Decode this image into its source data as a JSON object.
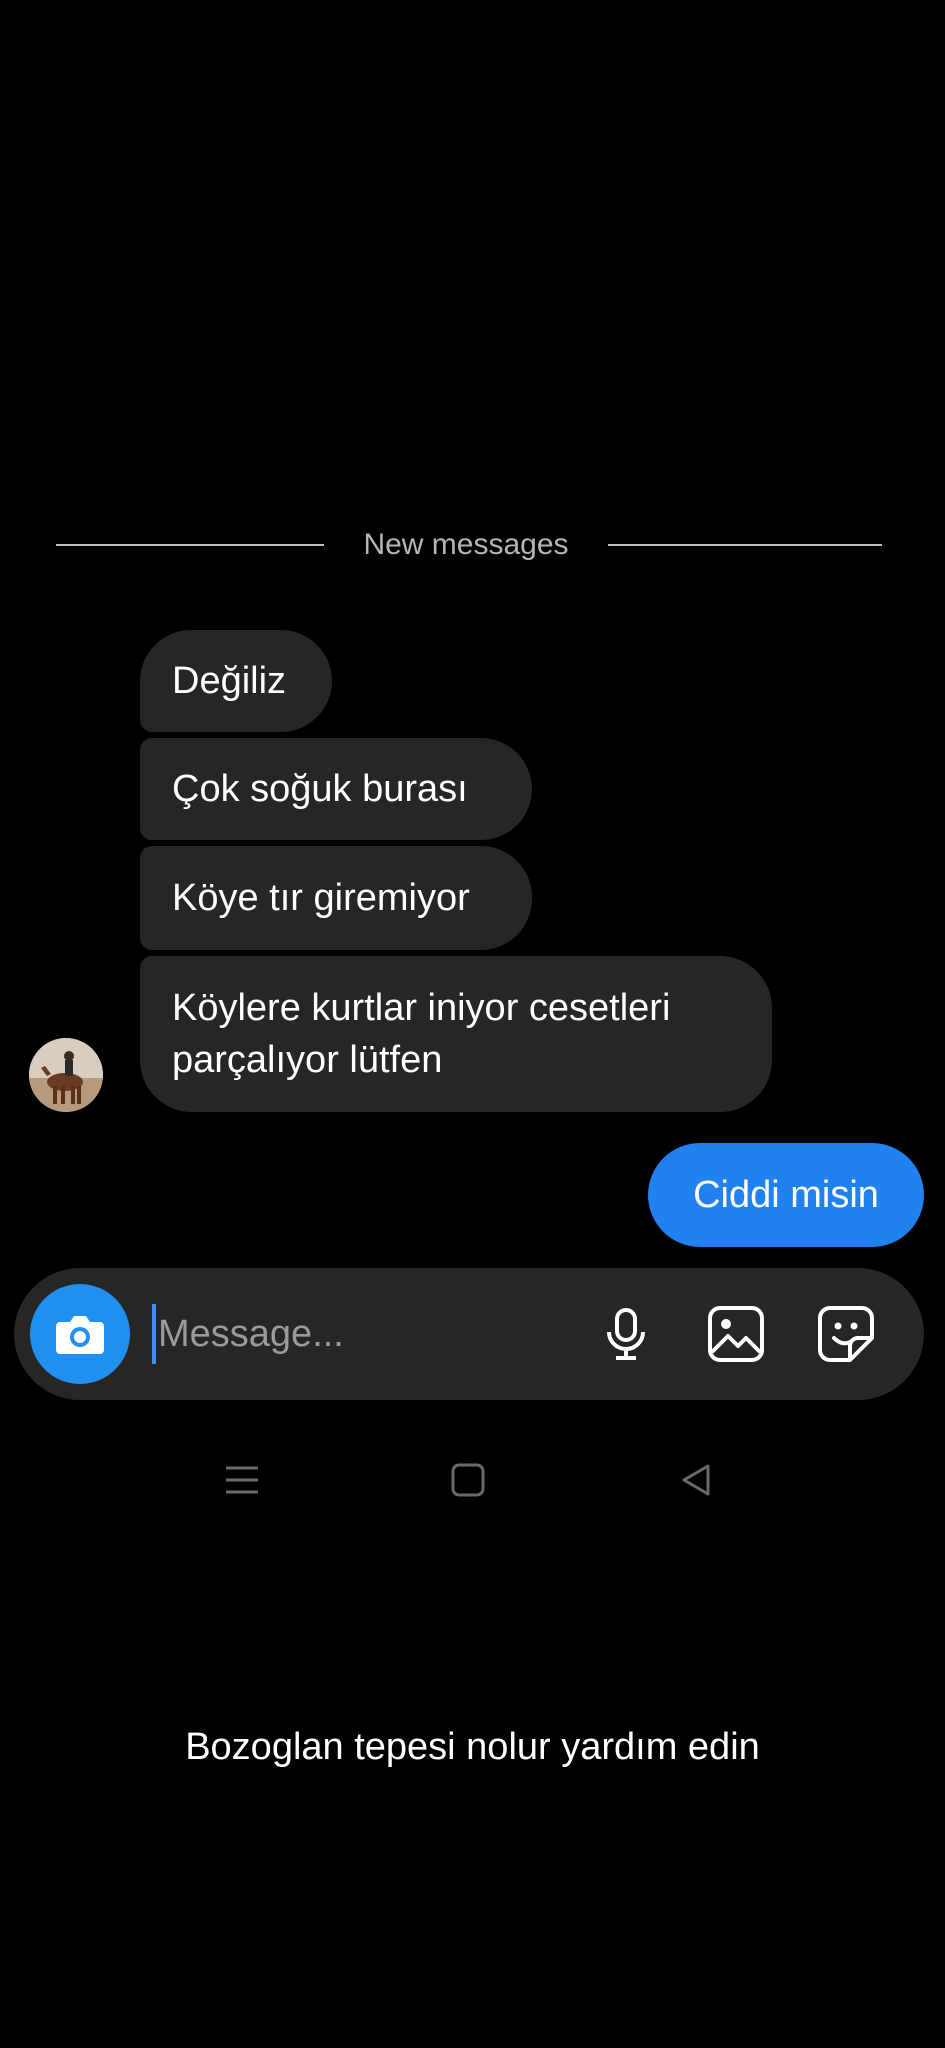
{
  "divider": {
    "label": "New messages"
  },
  "incoming_messages": [
    {
      "text": "Değiliz"
    },
    {
      "text": "Çok soğuk burası"
    },
    {
      "text": "Köye tır giremiyor"
    },
    {
      "text": "Köylere kurtlar iniyor cesetleri parçalıyor lütfen"
    }
  ],
  "outgoing_messages": [
    {
      "text": "Ciddi misin"
    }
  ],
  "composer": {
    "placeholder": "Message...",
    "camera_icon": "camera-icon",
    "mic_icon": "microphone-icon",
    "gallery_icon": "gallery-icon",
    "sticker_icon": "sticker-icon"
  },
  "navbar": {
    "menu_icon": "menu-icon",
    "home_icon": "home-icon",
    "back_icon": "back-icon"
  },
  "caption": "Bozoglan tepesi nolur yardım edin",
  "colors": {
    "background": "#000000",
    "incoming_bubble": "#262626",
    "outgoing_bubble": "#1f82f0",
    "camera_button": "#1f8ff0"
  }
}
